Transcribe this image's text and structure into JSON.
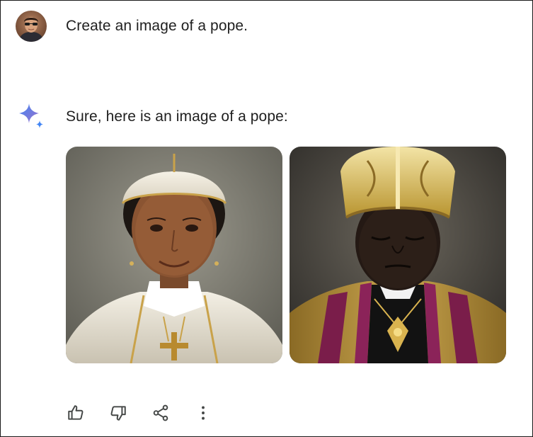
{
  "conversation": {
    "user": {
      "avatar_icon": "user-avatar-photo",
      "prompt": "Create an image of a pope."
    },
    "response": {
      "model_icon": "sparkle-icon",
      "text": "Sure, here is an image of a pope:",
      "images": [
        {
          "label": "generated-image-1"
        },
        {
          "label": "generated-image-2"
        }
      ]
    },
    "actions": [
      {
        "icon": "thumbs-up-icon"
      },
      {
        "icon": "thumbs-down-icon"
      },
      {
        "icon": "share-icon"
      },
      {
        "icon": "more-options-icon"
      }
    ]
  },
  "colors": {
    "text": "#1f1f1f",
    "icon": "#444746",
    "sparkle_blue": "#4285f4",
    "sparkle_purple": "#9b72cb"
  }
}
